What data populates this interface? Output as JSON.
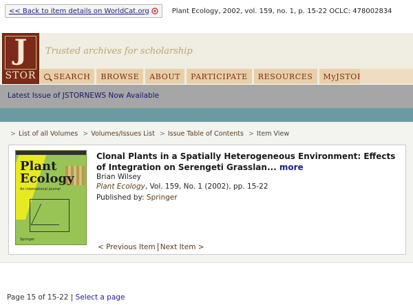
{
  "topbar": {
    "back_label": "<< Back to item details on WorldCat.org",
    "citation": "Plant Ecology, 2002, vol. 159, no. 1, p. 15-22   OCLC: 478002834"
  },
  "header": {
    "logo_letter": "J",
    "logo_text": "STOR",
    "tagline": "Trusted archives for scholarship"
  },
  "nav": {
    "items": [
      "SEARCH",
      "BROWSE",
      "ABOUT",
      "PARTICIPATE",
      "RESOURCES",
      "MyJSTOR"
    ]
  },
  "news": {
    "link": "Latest Issue of JSTORNEWS Now Available"
  },
  "breadcrumb": {
    "items": [
      "List of all Volumes",
      "Volumes/Issues List",
      "Issue Table of Contents"
    ],
    "current": "Item View"
  },
  "cover": {
    "title_line1": "Plant",
    "title_line2": "Ecology",
    "subtitle": "An international journal",
    "publisher": "Springer"
  },
  "article": {
    "title": "Clonal Plants in a Spatially Heterogeneous Environment: Effects of Integration on Serengeti Grasslan...",
    "more": "more",
    "author": "Brian Wilsey",
    "journal": "Plant Ecology",
    "details": ", Vol. 159, No. 1 (2002), pp. 15-22",
    "published_by_label": "Published by:",
    "publisher": "Springer"
  },
  "pager": {
    "prev": "< Previous Item",
    "next": "Next Item >"
  },
  "pageinfo": {
    "text": "Page 15 of 15-22",
    "sep": "|",
    "select": "Select a page"
  },
  "colors": {
    "brand": "#7a2c18",
    "nav_bg": "#e9cfa9",
    "news_bg": "#a6a6a6",
    "teal": "#6b9ba0"
  }
}
